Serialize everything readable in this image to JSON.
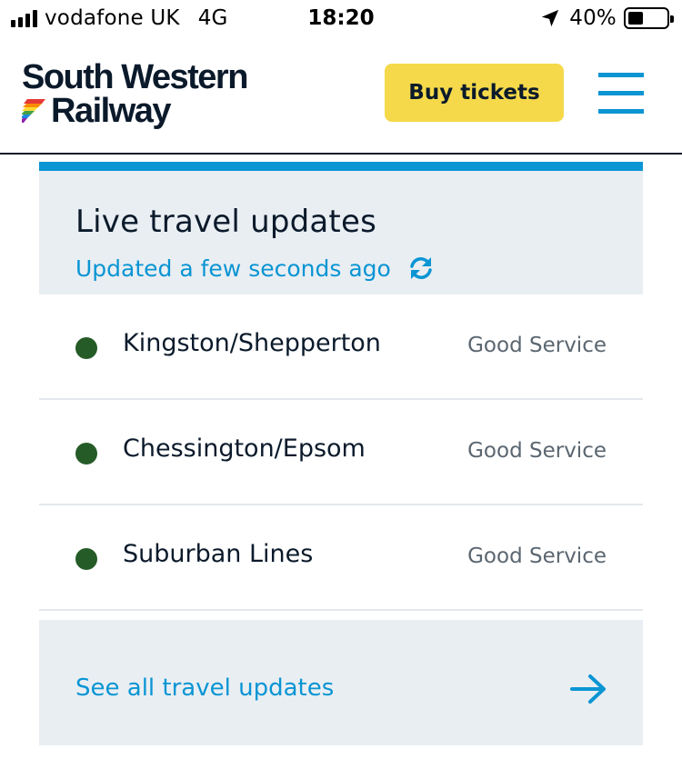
{
  "status_bar": {
    "carrier": "vodafone UK",
    "network": "4G",
    "time": "18:20",
    "battery": "40%",
    "battery_level": 0.4,
    "icons": [
      "signal-bars-icon",
      "location-arrow-icon",
      "battery-icon"
    ]
  },
  "header": {
    "logo_line1": "South Western",
    "logo_line2": "Railway",
    "buy_tickets": "Buy tickets",
    "menu_icon": "hamburger-menu-icon"
  },
  "travel": {
    "title": "Live travel updates",
    "updated": "Updated a few seconds ago",
    "refresh_icon": "refresh-icon",
    "lines": [
      {
        "name": "Kingston/Shepperton",
        "status": "Good Service",
        "status_color": "#255b27"
      },
      {
        "name": "Chessington/Epsom",
        "status": "Good Service",
        "status_color": "#255b27"
      },
      {
        "name": "Suburban Lines",
        "status": "Good Service",
        "status_color": "#255b27"
      }
    ],
    "see_all": "See all travel updates",
    "see_all_icon": "arrow-right-icon"
  },
  "colors": {
    "accent_blue": "#0a95d3",
    "button_yellow": "#f5d94a",
    "panel_bg": "#e9eef3",
    "text_dark": "#0b1a2b",
    "status_grey": "#5b6670"
  }
}
